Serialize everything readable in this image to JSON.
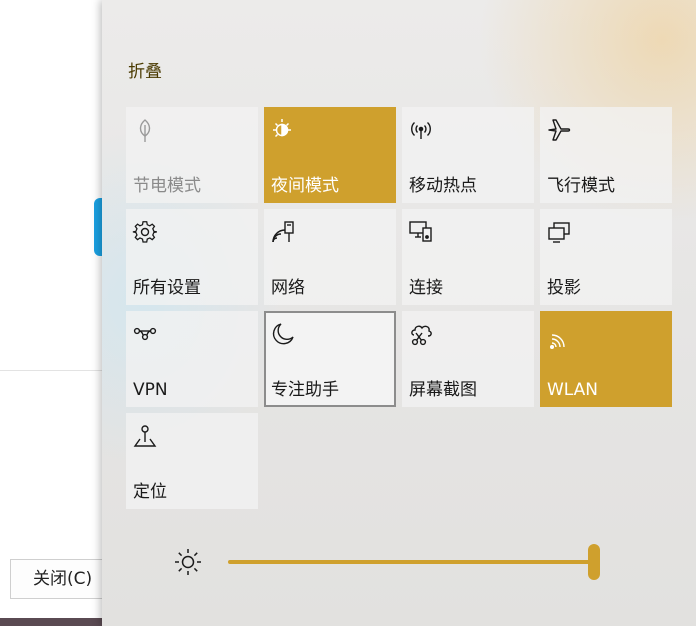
{
  "background_window": {
    "close_button_label": "关闭(C)"
  },
  "action_center": {
    "collapse_label": "折叠",
    "accent_color": "#cfa02d",
    "tiles": [
      {
        "label": "节电模式",
        "icon": "leaf-icon",
        "state": "disabled"
      },
      {
        "label": "夜间模式",
        "icon": "night-light-icon",
        "state": "on"
      },
      {
        "label": "移动热点",
        "icon": "hotspot-icon",
        "state": "off"
      },
      {
        "label": "飞行模式",
        "icon": "airplane-icon",
        "state": "off"
      },
      {
        "label": "所有设置",
        "icon": "gear-icon",
        "state": "off"
      },
      {
        "label": "网络",
        "icon": "network-icon",
        "state": "off"
      },
      {
        "label": "连接",
        "icon": "connect-icon",
        "state": "off"
      },
      {
        "label": "投影",
        "icon": "project-icon",
        "state": "off"
      },
      {
        "label": "VPN",
        "icon": "vpn-icon",
        "state": "off"
      },
      {
        "label": "专注助手",
        "icon": "moon-icon",
        "state": "focused"
      },
      {
        "label": "屏幕截图",
        "icon": "screen-snip-icon",
        "state": "off"
      },
      {
        "label": "WLAN",
        "icon": "wifi-icon",
        "state": "on"
      },
      {
        "label": "定位",
        "icon": "location-icon",
        "state": "off"
      }
    ],
    "brightness": {
      "icon": "sun-icon",
      "level": 1.0
    }
  }
}
